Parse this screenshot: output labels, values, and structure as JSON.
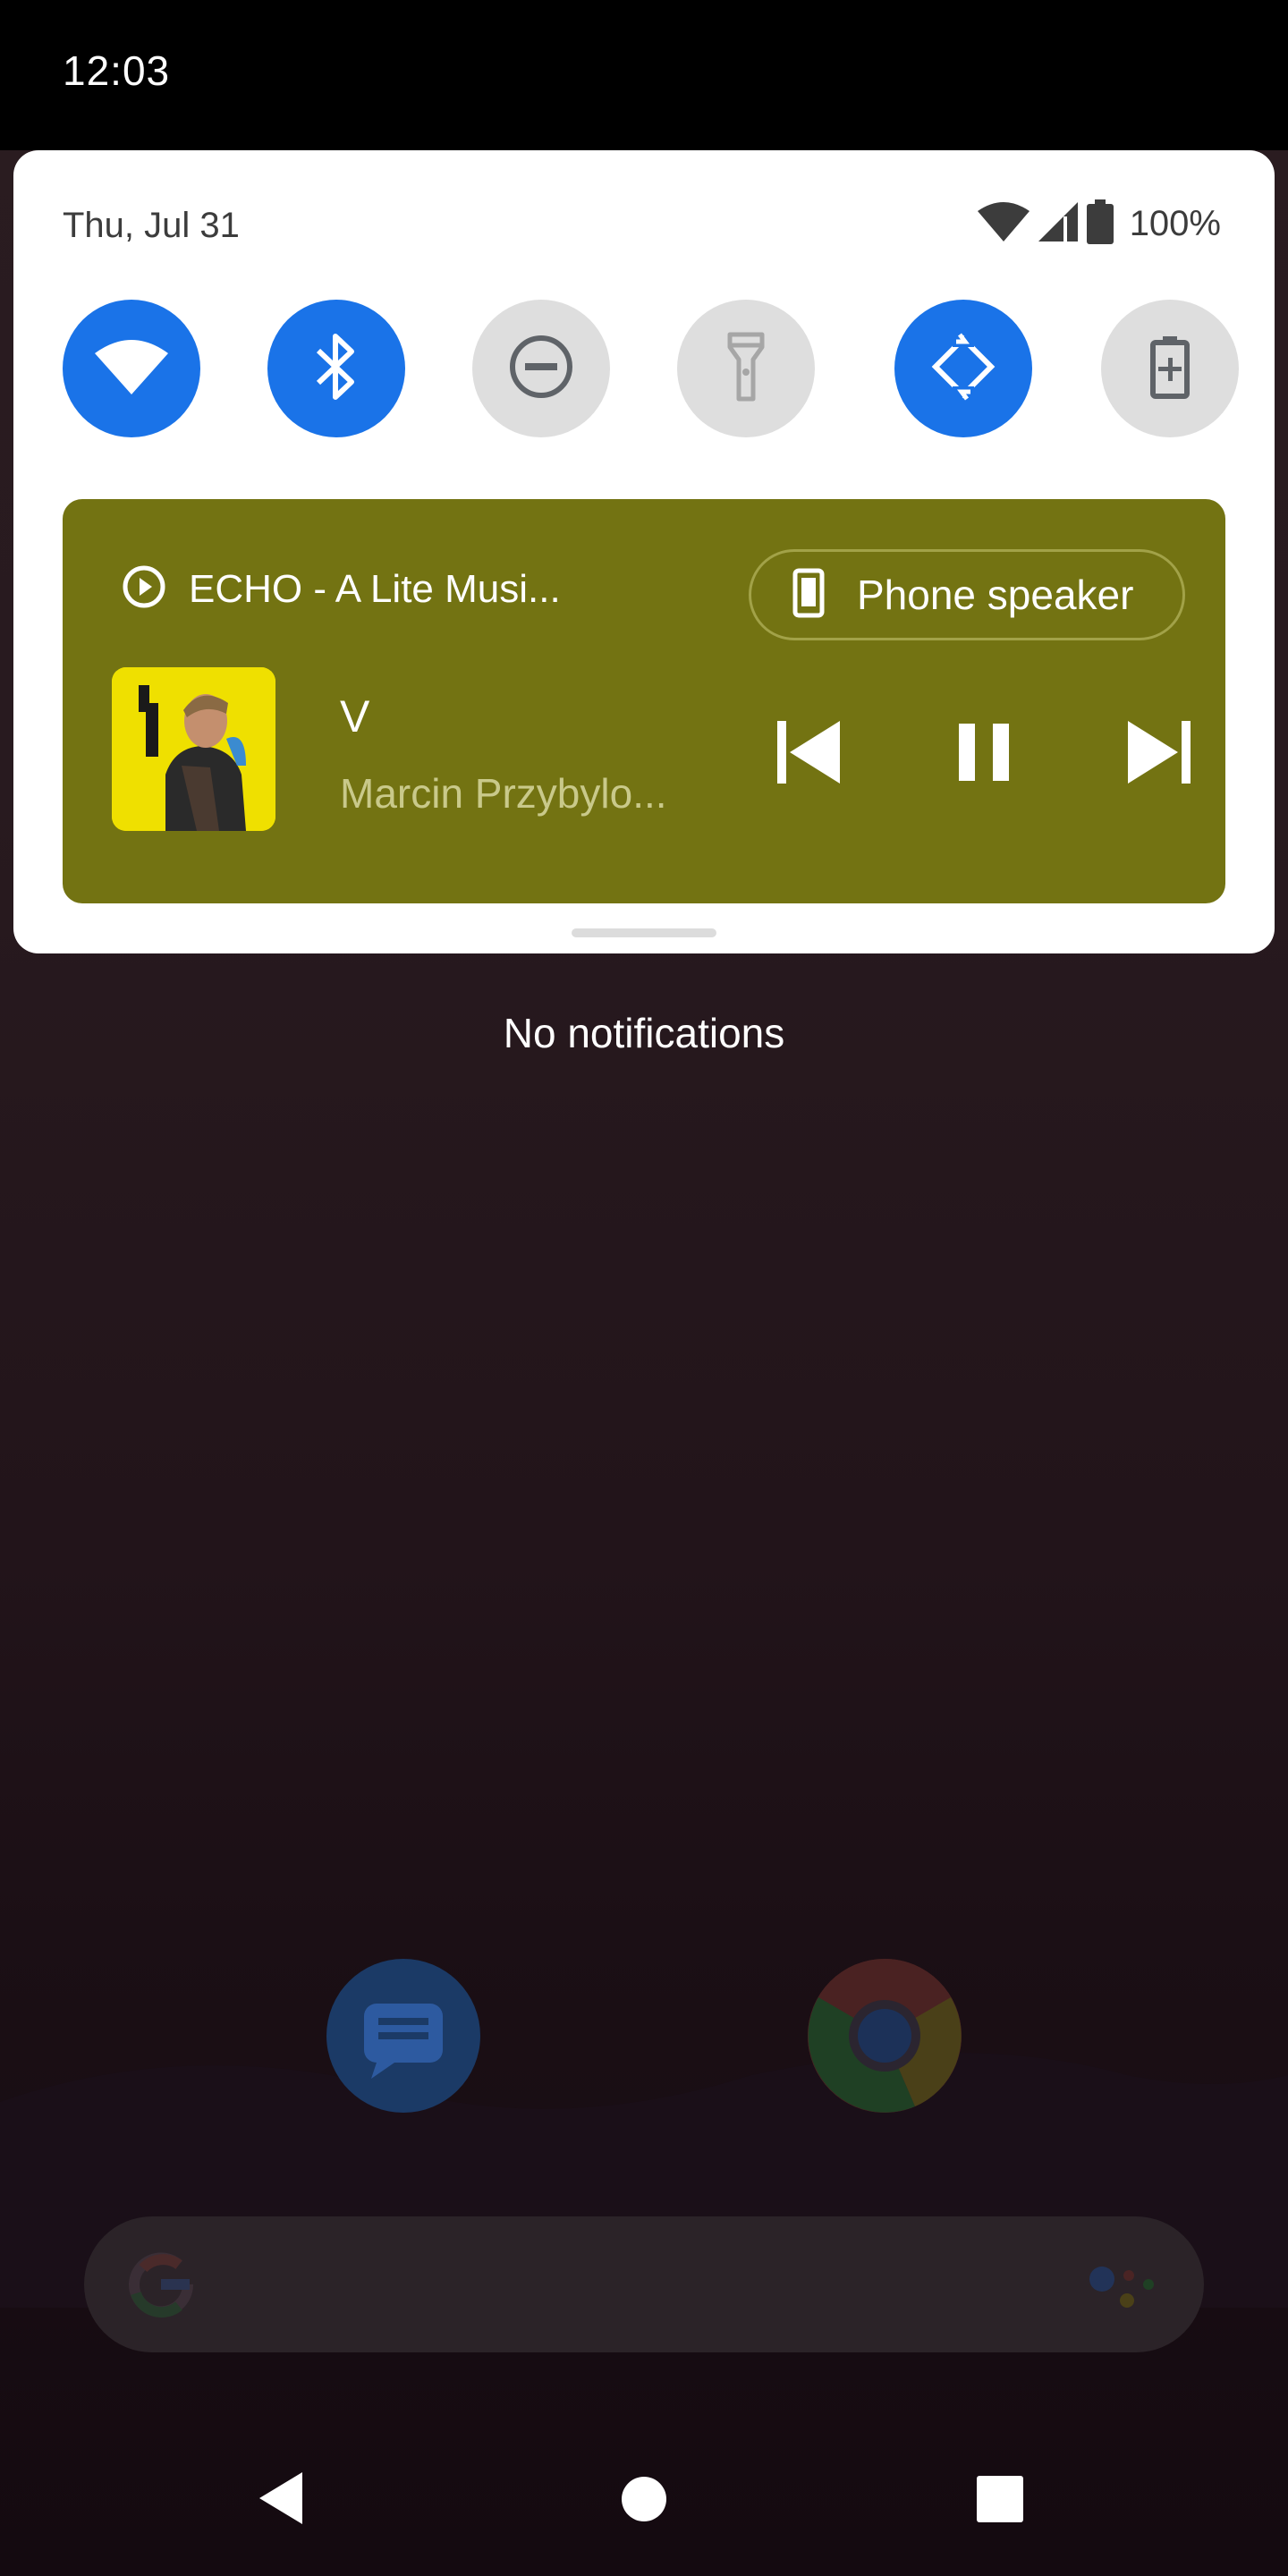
{
  "status_bar": {
    "time": "12:03"
  },
  "quick_settings": {
    "date": "Thu, Jul 31",
    "battery_percent": "100%",
    "tiles": [
      {
        "name": "wifi",
        "icon": "wifi-icon",
        "state": "on"
      },
      {
        "name": "bluetooth",
        "icon": "bluetooth-icon",
        "state": "on"
      },
      {
        "name": "do-not-disturb",
        "icon": "do-not-disturb-icon",
        "state": "off"
      },
      {
        "name": "flashlight",
        "icon": "flashlight-icon",
        "state": "off"
      },
      {
        "name": "auto-rotate",
        "icon": "auto-rotate-icon",
        "state": "on"
      },
      {
        "name": "battery-saver",
        "icon": "battery-saver-icon",
        "state": "off"
      }
    ]
  },
  "media": {
    "app_name": "ECHO - A Lite Musi...",
    "output_label": "Phone speaker",
    "title": "V",
    "artist": "Marcin Przybylo...",
    "background_color": "#737312",
    "state": "playing"
  },
  "notifications": {
    "empty_text": "No notifications"
  },
  "colors": {
    "tile_active": "#1a73e8",
    "tile_inactive": "#dedede"
  }
}
